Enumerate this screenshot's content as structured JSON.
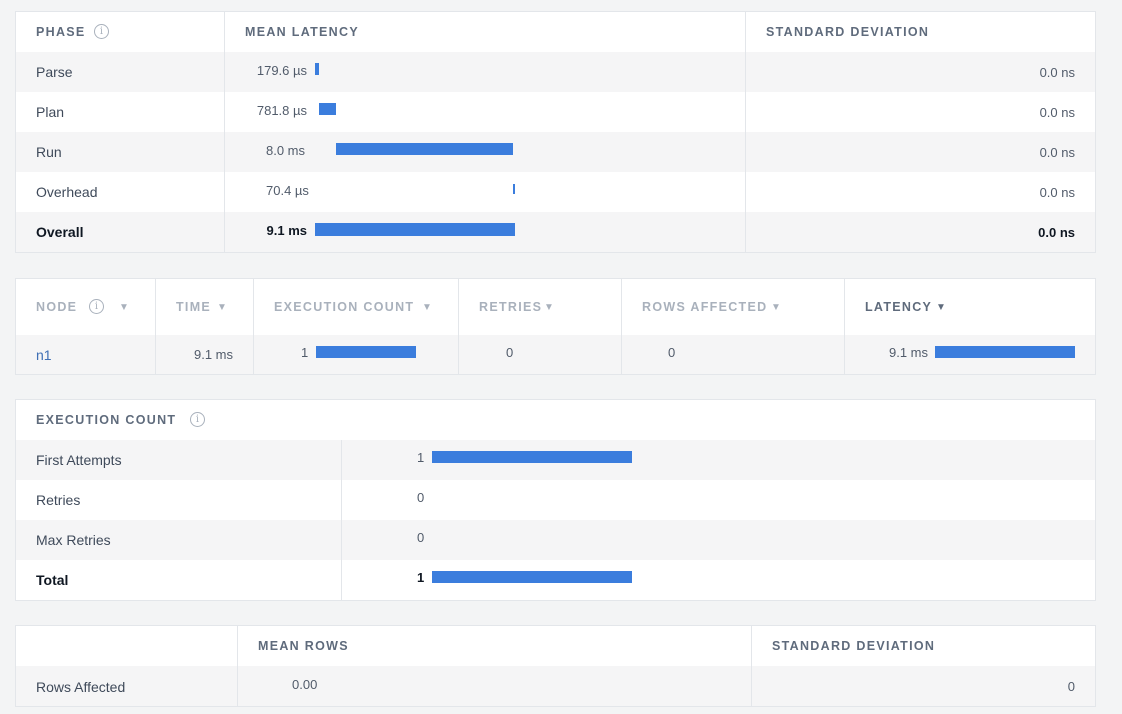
{
  "phase_table": {
    "headers": {
      "phase": "PHASE",
      "mean_latency": "MEAN LATENCY",
      "std_dev": "STANDARD DEVIATION"
    },
    "rows": [
      {
        "label": "Parse",
        "value": "179.6 µs",
        "std": "0.0 ns",
        "bar_start": 0.0,
        "bar_fraction": 0.02
      },
      {
        "label": "Plan",
        "value": "781.8 µs",
        "std": "0.0 ns",
        "bar_start": 0.02,
        "bar_fraction": 0.086
      },
      {
        "label": "Run",
        "value": "8.0 ms",
        "std": "0.0 ns",
        "bar_start": 0.106,
        "bar_fraction": 0.884
      },
      {
        "label": "Overhead",
        "value": "70.4 µs",
        "std": "0.0 ns",
        "bar_start": 0.99,
        "bar_fraction": 0.008
      },
      {
        "label": "Overall",
        "value": "9.1 ms",
        "std": "0.0 ns",
        "bar_start": 0.0,
        "bar_fraction": 1.0
      }
    ]
  },
  "node_table": {
    "headers": {
      "node": "NODE",
      "time": "TIME",
      "execution_count": "EXECUTION COUNT",
      "retries": "RETRIES",
      "rows_affected": "ROWS AFFECTED",
      "latency": "LATENCY"
    },
    "sort_caret": "▼",
    "rows": [
      {
        "node": "n1",
        "time": "9.1 ms",
        "execution_count": "1",
        "exec_fraction": 1.0,
        "retries": "0",
        "rows_affected": "0",
        "latency": "9.1 ms",
        "latency_fraction": 1.0
      }
    ]
  },
  "execution_count_table": {
    "header": "EXECUTION COUNT",
    "rows": [
      {
        "label": "First Attempts",
        "value": "1",
        "bar_fraction": 1.0
      },
      {
        "label": "Retries",
        "value": "0",
        "bar_fraction": 0.0
      },
      {
        "label": "Max Retries",
        "value": "0",
        "bar_fraction": 0.0
      },
      {
        "label": "Total",
        "value": "1",
        "bar_fraction": 1.0
      }
    ]
  },
  "rows_table": {
    "headers": {
      "mean_rows": "MEAN ROWS",
      "std_dev": "STANDARD DEVIATION"
    },
    "rows": [
      {
        "label": "Rows Affected",
        "mean": "0.00",
        "std": "0"
      }
    ]
  },
  "colors": {
    "bar": "#3b7ddd",
    "link": "#3f6fb5",
    "row_alt": "#f5f5f6"
  }
}
